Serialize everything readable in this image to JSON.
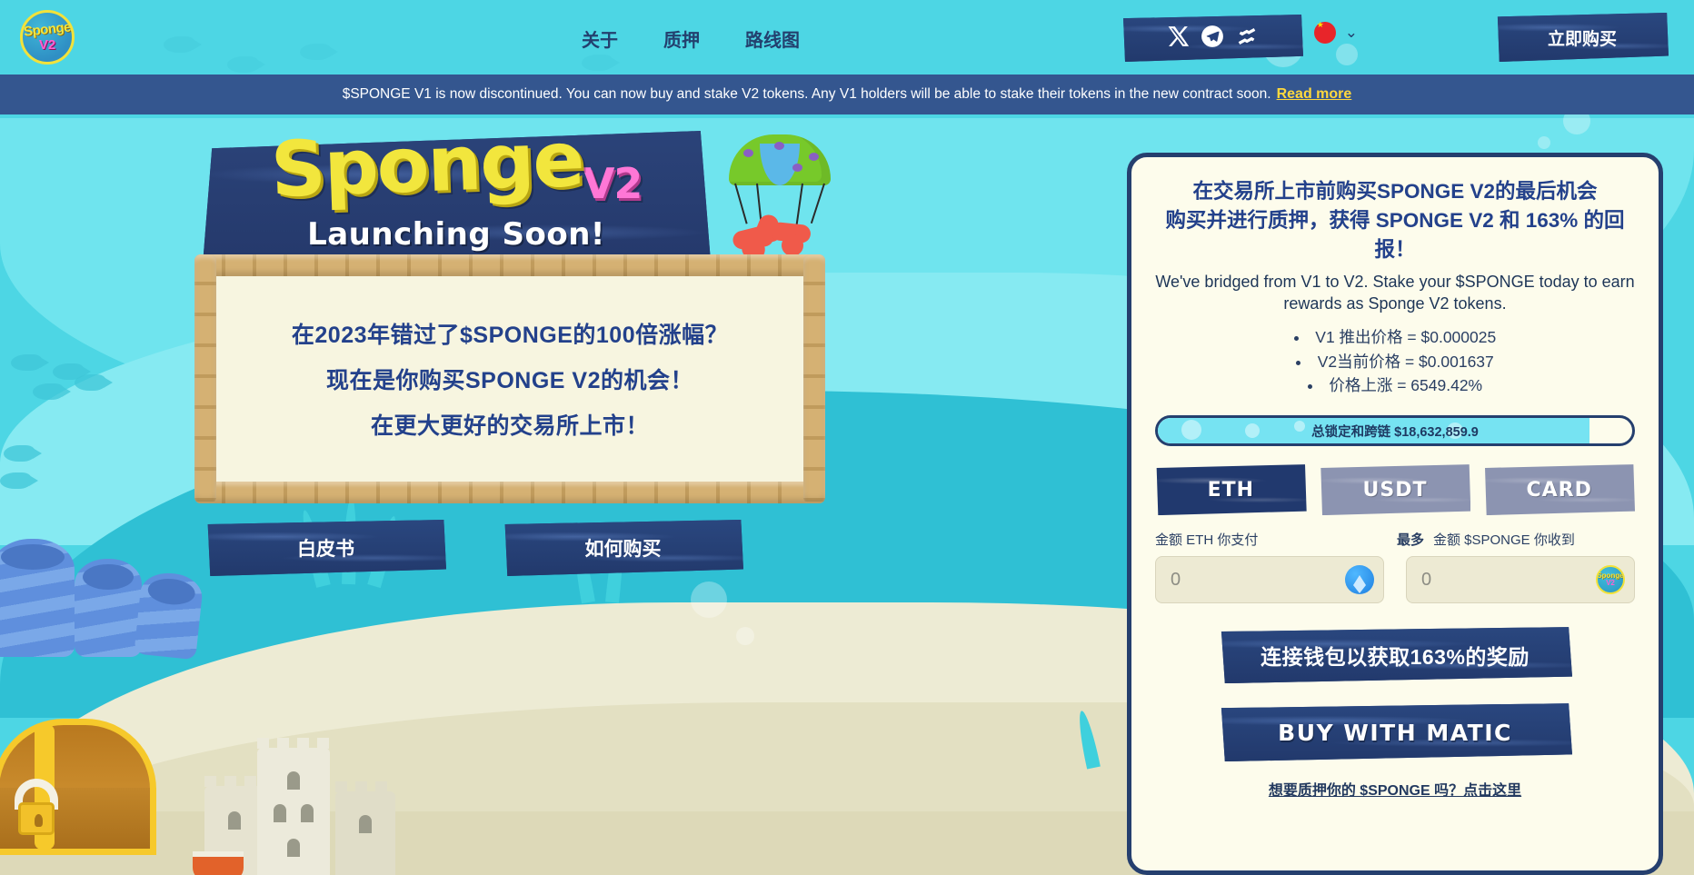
{
  "brand": {
    "logo_top": "Sponge",
    "logo_bottom": "V2"
  },
  "nav": {
    "links": [
      {
        "label": "关于"
      },
      {
        "label": "质押"
      },
      {
        "label": "路线图"
      }
    ],
    "socials": [
      {
        "name": "x-twitter-icon"
      },
      {
        "name": "telegram-icon"
      },
      {
        "name": "coinmarketcap-icon"
      }
    ],
    "language": {
      "flag": "CN",
      "chevron": "⌄"
    },
    "buy_now": "立即购买"
  },
  "announcement": {
    "text": "$SPONGE V1 is now discontinued. You can now buy and stake V2 tokens. Any V1 holders will be able to stake their tokens in the new contract soon.",
    "link": "Read more"
  },
  "hero": {
    "title_word": "Sponge",
    "title_version": "V2",
    "subtitle": "Launching Soon!",
    "sign_lines": [
      "在2023年错过了$SPONGE的100倍涨幅？",
      "现在是你购买SPONGE V2的机会！",
      "在更大更好的交易所上市！"
    ],
    "buttons": [
      {
        "label": "白皮书"
      },
      {
        "label": "如何购买"
      }
    ]
  },
  "panel": {
    "heading_line1": "在交易所上市前购买SPONGE V2的最后机会",
    "heading_line2": "购买并进行质押，获得 SPONGE V2 和 163% 的回报！",
    "subtext": "We've bridged from V1 to V2. Stake your $SPONGE today to earn rewards as Sponge V2 tokens.",
    "bullets": [
      "V1 推出价格 = $0.000025",
      "V2当前价格 = $0.001637",
      "价格上涨 = 6549.42%"
    ],
    "progress": {
      "label": "总锁定和跨链 $18,632,859.9",
      "percent": 91,
      "fill_color": "#76e3f2"
    },
    "payment_tabs": [
      {
        "label": "ETH",
        "active": true
      },
      {
        "label": "USDT",
        "active": false
      },
      {
        "label": "CARD",
        "active": false
      }
    ],
    "pay_label": "金额 ETH 你支付",
    "max_label": "最多",
    "receive_label": "金额 $SPONGE 你收到",
    "pay_value": "0",
    "receive_value": "0",
    "pay_coin": "eth-icon",
    "receive_coin": "sponge-v2-icon",
    "connect_button": "连接钱包以获取163%的奖励",
    "matic_button": "BUY WITH MATIC",
    "stake_link": "想要质押你的 $SPONGE 吗？点击这里"
  },
  "colors": {
    "navy": "#253f6e",
    "cream": "#fdfcec",
    "cyan": "#4dd6e4",
    "accent_yellow": "#f2e63d",
    "accent_pink": "#ff77d6",
    "banner_blue": "#34568f"
  }
}
